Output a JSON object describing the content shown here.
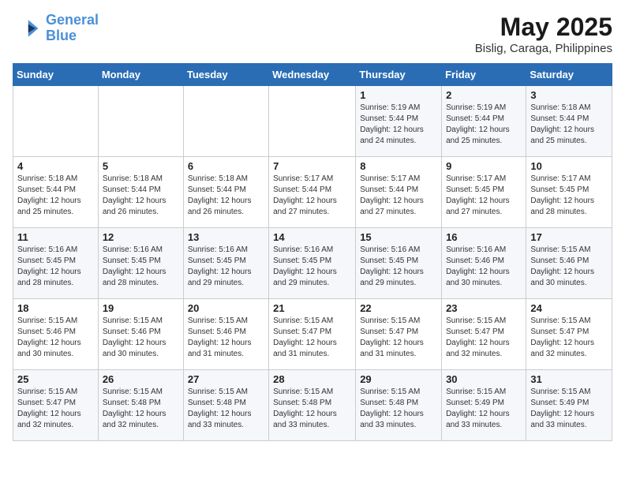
{
  "header": {
    "logo_line1": "General",
    "logo_line2": "Blue",
    "title": "May 2025",
    "subtitle": "Bislig, Caraga, Philippines"
  },
  "days_of_week": [
    "Sunday",
    "Monday",
    "Tuesday",
    "Wednesday",
    "Thursday",
    "Friday",
    "Saturday"
  ],
  "weeks": [
    [
      {
        "day": "",
        "info": ""
      },
      {
        "day": "",
        "info": ""
      },
      {
        "day": "",
        "info": ""
      },
      {
        "day": "",
        "info": ""
      },
      {
        "day": "1",
        "info": "Sunrise: 5:19 AM\nSunset: 5:44 PM\nDaylight: 12 hours\nand 24 minutes."
      },
      {
        "day": "2",
        "info": "Sunrise: 5:19 AM\nSunset: 5:44 PM\nDaylight: 12 hours\nand 25 minutes."
      },
      {
        "day": "3",
        "info": "Sunrise: 5:18 AM\nSunset: 5:44 PM\nDaylight: 12 hours\nand 25 minutes."
      }
    ],
    [
      {
        "day": "4",
        "info": "Sunrise: 5:18 AM\nSunset: 5:44 PM\nDaylight: 12 hours\nand 25 minutes."
      },
      {
        "day": "5",
        "info": "Sunrise: 5:18 AM\nSunset: 5:44 PM\nDaylight: 12 hours\nand 26 minutes."
      },
      {
        "day": "6",
        "info": "Sunrise: 5:18 AM\nSunset: 5:44 PM\nDaylight: 12 hours\nand 26 minutes."
      },
      {
        "day": "7",
        "info": "Sunrise: 5:17 AM\nSunset: 5:44 PM\nDaylight: 12 hours\nand 27 minutes."
      },
      {
        "day": "8",
        "info": "Sunrise: 5:17 AM\nSunset: 5:44 PM\nDaylight: 12 hours\nand 27 minutes."
      },
      {
        "day": "9",
        "info": "Sunrise: 5:17 AM\nSunset: 5:45 PM\nDaylight: 12 hours\nand 27 minutes."
      },
      {
        "day": "10",
        "info": "Sunrise: 5:17 AM\nSunset: 5:45 PM\nDaylight: 12 hours\nand 28 minutes."
      }
    ],
    [
      {
        "day": "11",
        "info": "Sunrise: 5:16 AM\nSunset: 5:45 PM\nDaylight: 12 hours\nand 28 minutes."
      },
      {
        "day": "12",
        "info": "Sunrise: 5:16 AM\nSunset: 5:45 PM\nDaylight: 12 hours\nand 28 minutes."
      },
      {
        "day": "13",
        "info": "Sunrise: 5:16 AM\nSunset: 5:45 PM\nDaylight: 12 hours\nand 29 minutes."
      },
      {
        "day": "14",
        "info": "Sunrise: 5:16 AM\nSunset: 5:45 PM\nDaylight: 12 hours\nand 29 minutes."
      },
      {
        "day": "15",
        "info": "Sunrise: 5:16 AM\nSunset: 5:45 PM\nDaylight: 12 hours\nand 29 minutes."
      },
      {
        "day": "16",
        "info": "Sunrise: 5:16 AM\nSunset: 5:46 PM\nDaylight: 12 hours\nand 30 minutes."
      },
      {
        "day": "17",
        "info": "Sunrise: 5:15 AM\nSunset: 5:46 PM\nDaylight: 12 hours\nand 30 minutes."
      }
    ],
    [
      {
        "day": "18",
        "info": "Sunrise: 5:15 AM\nSunset: 5:46 PM\nDaylight: 12 hours\nand 30 minutes."
      },
      {
        "day": "19",
        "info": "Sunrise: 5:15 AM\nSunset: 5:46 PM\nDaylight: 12 hours\nand 30 minutes."
      },
      {
        "day": "20",
        "info": "Sunrise: 5:15 AM\nSunset: 5:46 PM\nDaylight: 12 hours\nand 31 minutes."
      },
      {
        "day": "21",
        "info": "Sunrise: 5:15 AM\nSunset: 5:47 PM\nDaylight: 12 hours\nand 31 minutes."
      },
      {
        "day": "22",
        "info": "Sunrise: 5:15 AM\nSunset: 5:47 PM\nDaylight: 12 hours\nand 31 minutes."
      },
      {
        "day": "23",
        "info": "Sunrise: 5:15 AM\nSunset: 5:47 PM\nDaylight: 12 hours\nand 32 minutes."
      },
      {
        "day": "24",
        "info": "Sunrise: 5:15 AM\nSunset: 5:47 PM\nDaylight: 12 hours\nand 32 minutes."
      }
    ],
    [
      {
        "day": "25",
        "info": "Sunrise: 5:15 AM\nSunset: 5:47 PM\nDaylight: 12 hours\nand 32 minutes."
      },
      {
        "day": "26",
        "info": "Sunrise: 5:15 AM\nSunset: 5:48 PM\nDaylight: 12 hours\nand 32 minutes."
      },
      {
        "day": "27",
        "info": "Sunrise: 5:15 AM\nSunset: 5:48 PM\nDaylight: 12 hours\nand 33 minutes."
      },
      {
        "day": "28",
        "info": "Sunrise: 5:15 AM\nSunset: 5:48 PM\nDaylight: 12 hours\nand 33 minutes."
      },
      {
        "day": "29",
        "info": "Sunrise: 5:15 AM\nSunset: 5:48 PM\nDaylight: 12 hours\nand 33 minutes."
      },
      {
        "day": "30",
        "info": "Sunrise: 5:15 AM\nSunset: 5:49 PM\nDaylight: 12 hours\nand 33 minutes."
      },
      {
        "day": "31",
        "info": "Sunrise: 5:15 AM\nSunset: 5:49 PM\nDaylight: 12 hours\nand 33 minutes."
      }
    ]
  ]
}
